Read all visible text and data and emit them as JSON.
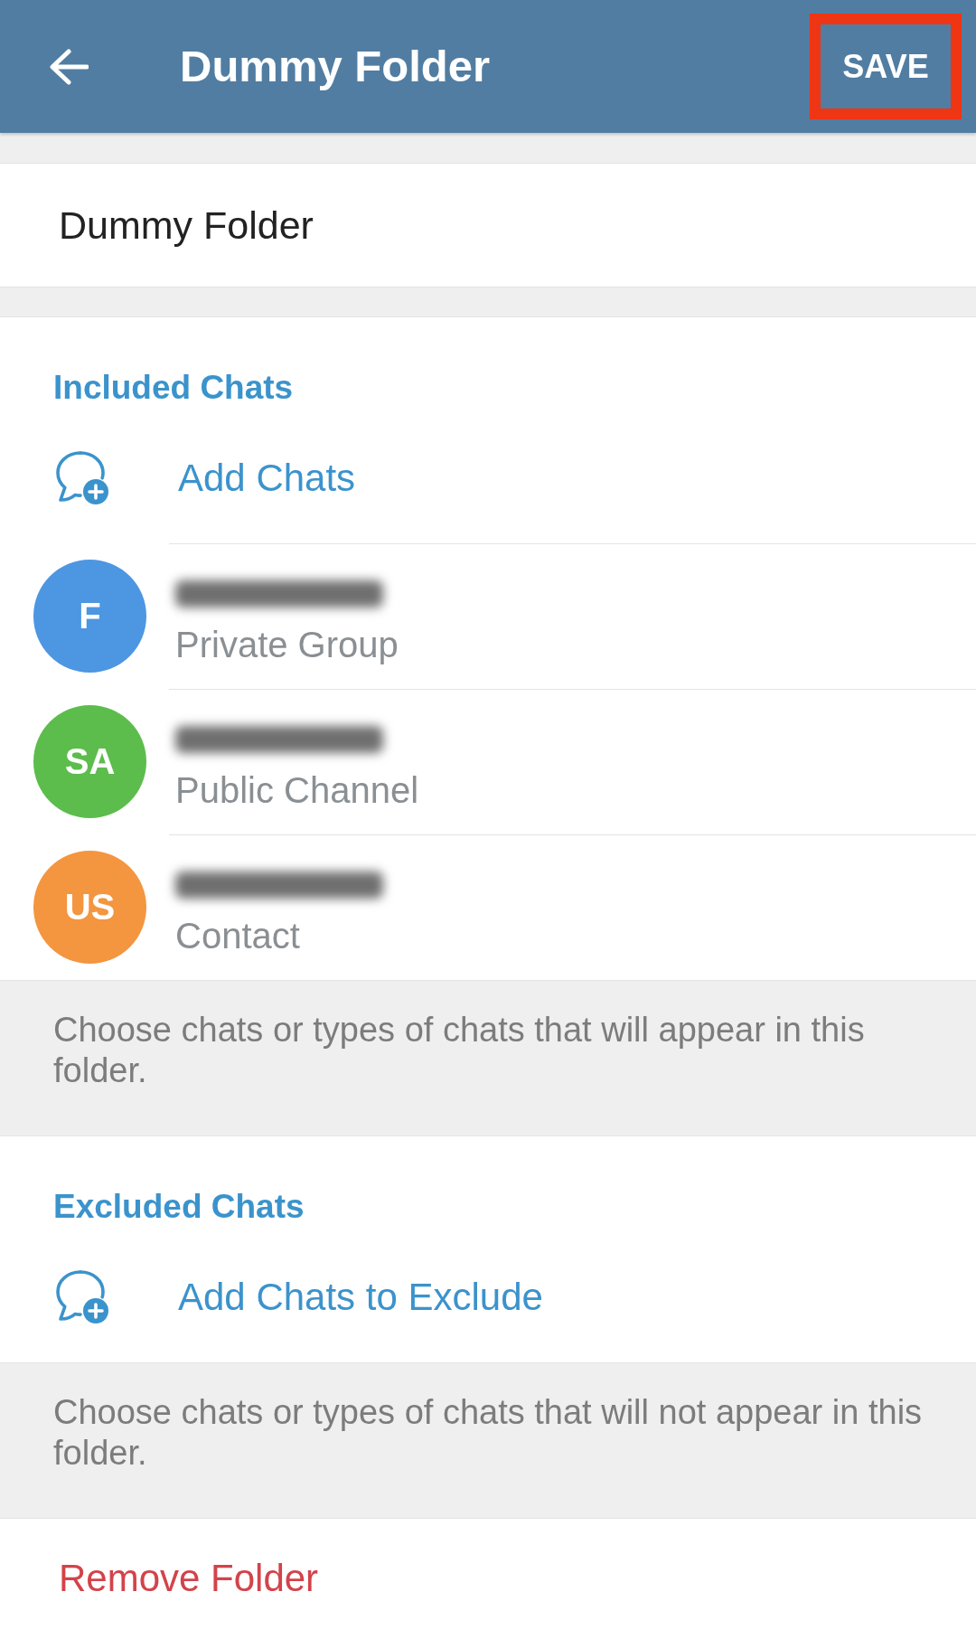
{
  "header": {
    "title": "Dummy Folder",
    "save_button": {
      "label": "SAVE",
      "highlighted": true
    }
  },
  "name_field": {
    "value": "Dummy Folder"
  },
  "included_chats": {
    "heading": "Included Chats",
    "add_button": "Add Chats",
    "chats": [
      {
        "initials": "F",
        "type": "Private Group",
        "color": "#4d96e2"
      },
      {
        "initials": "SA",
        "type": "Public Channel",
        "color": "#5cbd4c"
      },
      {
        "initials": "US",
        "type": "Contact",
        "color": "#f4953f"
      }
    ]
  },
  "included_note": "Choose chats or types of chats that will appear in this folder.",
  "excluded_chats": {
    "heading": "Excluded Chats",
    "add_button": "Add Chats to Exclude"
  },
  "excluded_note": "Choose chats or types of chats that will not appear in this folder.",
  "remove_button": "Remove Folder"
}
